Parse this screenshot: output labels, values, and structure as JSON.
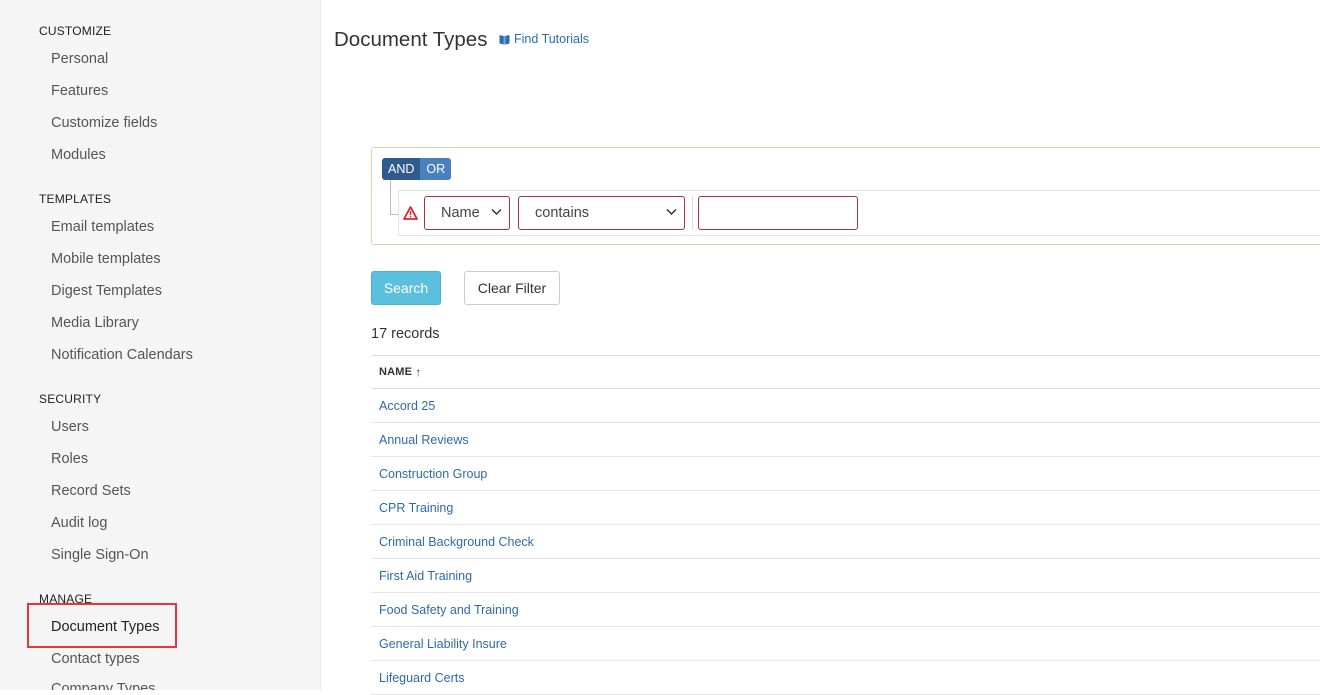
{
  "sidebar": {
    "groups": [
      {
        "heading": "CUSTOMIZE",
        "items": [
          "Personal",
          "Features",
          "Customize fields",
          "Modules"
        ]
      },
      {
        "heading": "TEMPLATES",
        "items": [
          "Email templates",
          "Mobile templates",
          "Digest Templates",
          "Media Library",
          "Notification Calendars"
        ]
      },
      {
        "heading": "SECURITY",
        "items": [
          "Users",
          "Roles",
          "Record Sets",
          "Audit log",
          "Single Sign-On"
        ]
      },
      {
        "heading": "MANAGE",
        "items": [
          "Document Types",
          "Contact types",
          "Company Types"
        ]
      }
    ],
    "active_item": "Document Types"
  },
  "header": {
    "title": "Document Types",
    "tutorials_label": "Find Tutorials"
  },
  "filter": {
    "and_label": "AND",
    "or_label": "OR",
    "field_value": "Name",
    "operator_value": "contains",
    "value_input": ""
  },
  "actions": {
    "search_label": "Search",
    "clear_label": "Clear Filter"
  },
  "records_count": "17 records",
  "table": {
    "column_header": "NAME",
    "sort_indicator": "↑",
    "rows": [
      "Accord 25",
      "Annual Reviews",
      "Construction Group",
      "CPR Training",
      "Criminal Background Check",
      "First Aid Training",
      "Food Safety and Training",
      "General Liability Insure",
      "Lifeguard Certs"
    ]
  },
  "colors": {
    "accent": "#2f5a8d",
    "link": "#2f6aa8",
    "search_button": "#5bc0de",
    "error_border": "#a8343c",
    "highlight": "#e4383d"
  },
  "icons": {
    "tutorials": "book-icon",
    "warning": "warning-triangle-icon",
    "dropdown": "chevron-down-icon"
  }
}
